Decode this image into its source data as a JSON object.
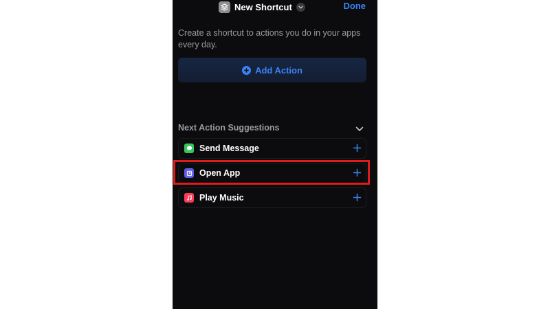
{
  "nav": {
    "title": "New Shortcut",
    "done_label": "Done",
    "app_icon": "shortcuts-layers-icon",
    "title_chevron_icon": "chevron-down-icon"
  },
  "intro": {
    "description": "Create a shortcut to actions you do in your apps every day."
  },
  "add_action": {
    "label": "Add Action",
    "icon": "plus-circle-icon"
  },
  "suggestions": {
    "title": "Next Action Suggestions",
    "collapse_icon": "chevron-down-icon",
    "items": [
      {
        "label": "Send Message",
        "icon": "messages-icon",
        "icon_color": "#34c759"
      },
      {
        "label": "Open App",
        "icon": "open-app-icon",
        "icon_color": "#5e5ce6"
      },
      {
        "label": "Play Music",
        "icon": "music-note-icon",
        "icon_color": "#fa3c5a"
      }
    ]
  },
  "colors": {
    "accent": "#3b82f6",
    "background": "#0c0c0e",
    "highlight": "#e01b1b"
  }
}
